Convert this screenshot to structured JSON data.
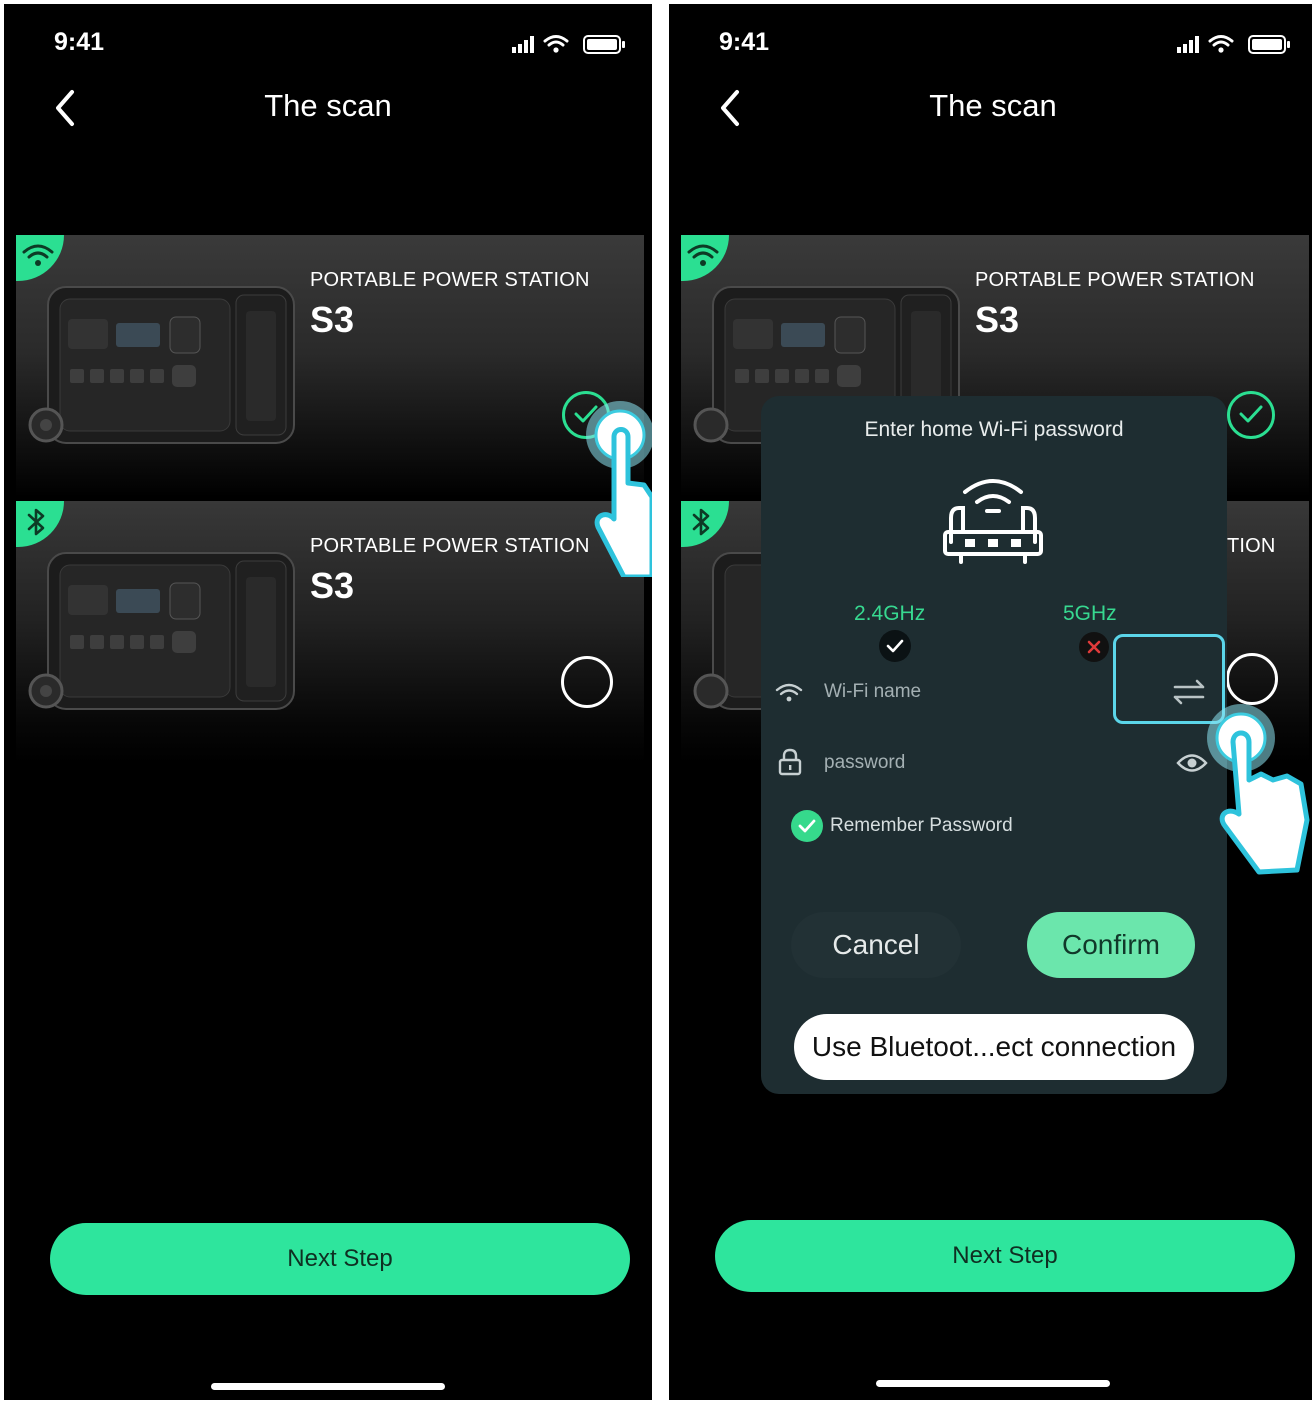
{
  "left": {
    "status_time": "9:41",
    "title": "The scan",
    "devices": [
      {
        "subtitle": "PORTABLE POWER STATION",
        "model": "S3",
        "connection": "wifi-icon",
        "selected": true
      },
      {
        "subtitle": "PORTABLE POWER STATION",
        "model": "S3",
        "connection": "bluetooth-icon",
        "selected": false
      }
    ],
    "next_label": "Next Step"
  },
  "right": {
    "status_time": "9:41",
    "title": "The scan",
    "devices": [
      {
        "subtitle": "PORTABLE POWER STATION",
        "model": "S3",
        "connection": "wifi-icon",
        "selected": true
      },
      {
        "subtitle_partial": "TION",
        "connection": "bluetooth-icon",
        "selected": false
      }
    ],
    "next_label": "Next Step",
    "dialog": {
      "title": "Enter home Wi-Fi password",
      "band_24": "2.4GHz",
      "band_5": "5GHz",
      "wifi_placeholder": "Wi-Fi name",
      "password_placeholder": "password",
      "remember_label": "Remember Password",
      "cancel_label": "Cancel",
      "confirm_label": "Confirm",
      "bluetooth_label": "Use Bluetoot...ect connection"
    }
  },
  "colors": {
    "accent": "#2ee59d",
    "background": "#000000",
    "dialog_bg": "#1e2d31",
    "highlight": "#5bd5e9"
  }
}
